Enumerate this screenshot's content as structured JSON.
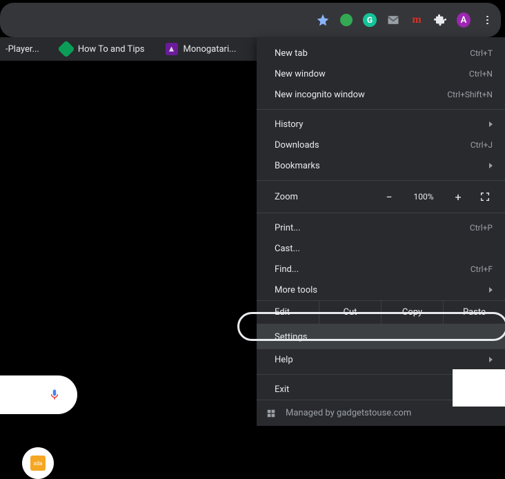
{
  "toolbar": {
    "avatar_letter": "A"
  },
  "bookmarks": {
    "items": [
      {
        "label": "-Player..."
      },
      {
        "label": "How To and Tips"
      },
      {
        "label": "Monogatari..."
      }
    ]
  },
  "xda_label": "xda",
  "menu": {
    "new_tab": "New tab",
    "new_tab_sc": "Ctrl+T",
    "new_window": "New window",
    "new_window_sc": "Ctrl+N",
    "incognito": "New incognito window",
    "incognito_sc": "Ctrl+Shift+N",
    "history": "History",
    "downloads": "Downloads",
    "downloads_sc": "Ctrl+J",
    "bookmarks": "Bookmarks",
    "zoom_label": "Zoom",
    "zoom_value": "100%",
    "print": "Print...",
    "print_sc": "Ctrl+P",
    "cast": "Cast...",
    "find": "Find...",
    "find_sc": "Ctrl+F",
    "more_tools": "More tools",
    "edit": "Edit",
    "cut": "Cut",
    "copy": "Copy",
    "paste": "Paste",
    "settings": "Settings",
    "help": "Help",
    "exit": "Exit",
    "managed": "Managed by gadgetstouse.com"
  }
}
